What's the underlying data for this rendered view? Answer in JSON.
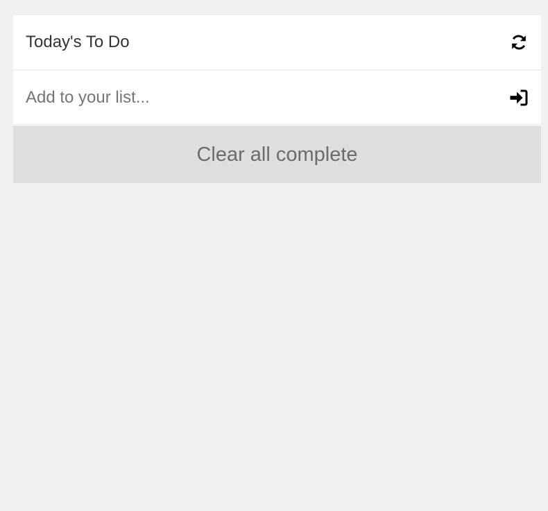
{
  "header": {
    "title": "Today's To Do",
    "refresh_icon": "refresh-icon"
  },
  "add": {
    "placeholder": "Add to your list...",
    "value": "",
    "submit_icon": "sign-in-icon"
  },
  "actions": {
    "clear_label": "Clear all complete"
  },
  "colors": {
    "background": "#f1f1f1",
    "panel": "#ffffff",
    "button": "#dedede",
    "button_text": "#6b6b6b",
    "text": "#333333"
  },
  "todos": []
}
